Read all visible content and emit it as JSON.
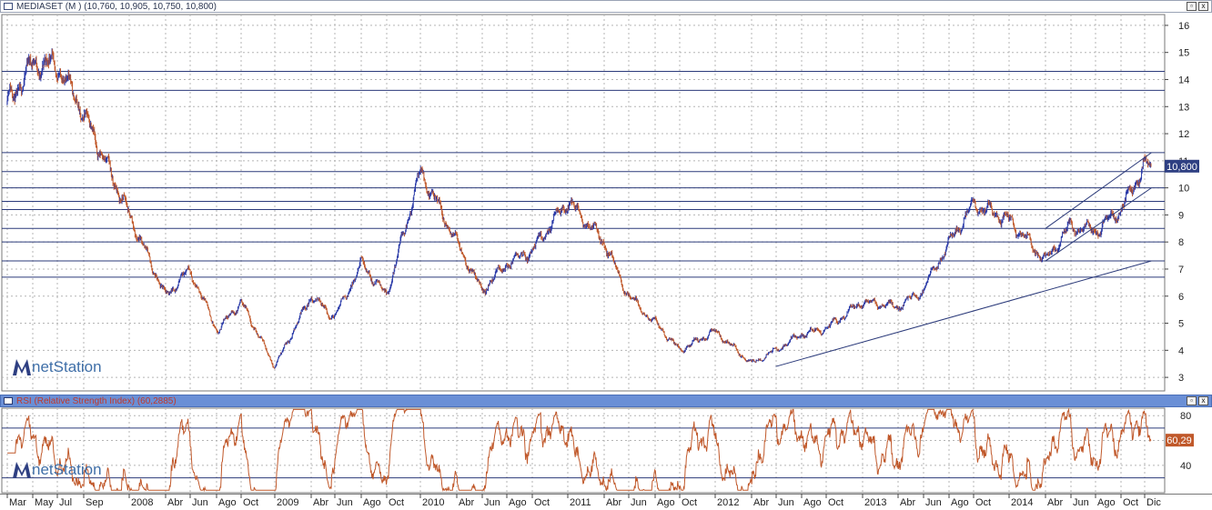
{
  "main_panel": {
    "title": "MEDIASET (M ) (10,760, 10,905, 10,750, 10,800)",
    "price_badge": "10,800",
    "restore_label": "▫",
    "close_label": "x"
  },
  "rsi_panel": {
    "title": "RSI (Relative Strength Index) (60,2885)",
    "value_badge": "60,29",
    "restore_label": "▫",
    "close_label": "x"
  },
  "watermark": {
    "text": "netStation"
  },
  "colors": {
    "up_bar": "#2a3aa8",
    "down_bar": "#c0582a",
    "rsi_line": "#c0582a",
    "grid": "#b5b5b5",
    "hline": "#2b3a7a",
    "badge_price": "#2e3f82",
    "badge_rsi": "#c0582a",
    "rsi_title_bar": "#6a8fd6"
  },
  "chart_data": [
    {
      "type": "line",
      "subtype": "ohlc",
      "series": [
        {
          "name": "MEDIASET",
          "x": [
            "2007-03",
            "2007-05",
            "2007-07",
            "2007-09",
            "2008-01",
            "2008-04",
            "2008-06",
            "2008-08",
            "2008-10",
            "2009-01",
            "2009-04",
            "2009-06",
            "2009-08",
            "2009-10",
            "2010-01",
            "2010-04",
            "2010-06",
            "2010-08",
            "2010-10",
            "2011-01",
            "2011-04",
            "2011-06",
            "2011-08",
            "2011-10",
            "2012-01",
            "2012-04",
            "2012-06",
            "2012-08",
            "2012-10",
            "2013-01",
            "2013-04",
            "2013-06",
            "2013-08",
            "2013-10",
            "2014-01",
            "2014-04",
            "2014-06",
            "2014-08",
            "2014-10",
            "2014-12"
          ],
          "values": [
            13.1,
            14.6,
            14.5,
            12.8,
            9.0,
            6.0,
            7.0,
            4.7,
            5.8,
            3.4,
            6.0,
            5.2,
            7.2,
            6.0,
            10.6,
            8.0,
            6.2,
            7.2,
            7.7,
            9.5,
            8.0,
            6.0,
            5.0,
            4.0,
            4.7,
            3.5,
            4.0,
            4.6,
            4.8,
            5.8,
            5.6,
            6.2,
            8.0,
            9.4,
            8.8,
            7.3,
            8.6,
            8.4,
            9.2,
            10.8
          ]
        }
      ],
      "y_ticks": [
        3,
        4,
        5,
        6,
        7,
        8,
        9,
        10,
        11,
        12,
        13,
        14,
        15,
        16
      ],
      "ylim": [
        2.5,
        16.4
      ],
      "horizontal_levels": [
        14.3,
        13.6,
        11.3,
        10.6,
        10.0,
        9.5,
        9.2,
        8.5,
        8.0,
        7.3,
        6.7
      ],
      "trendlines": [
        {
          "from": [
            "2012-06",
            3.4
          ],
          "to": [
            "2014-04",
            7.3
          ]
        },
        {
          "from": [
            "2014-04",
            7.3
          ],
          "to": [
            "2014-12",
            10.0
          ]
        },
        {
          "from": [
            "2014-04",
            8.5
          ],
          "to": [
            "2014-12",
            11.3
          ]
        }
      ],
      "last_value": 10.8,
      "grid": true
    },
    {
      "type": "line",
      "title": "RSI (Relative Strength Index) (60,2885)",
      "series": [
        {
          "name": "RSI",
          "value": 60.29
        }
      ],
      "y_ticks": [
        40,
        60,
        80
      ],
      "ylim": [
        18,
        86
      ],
      "horizontal_levels": [
        70,
        30
      ],
      "grid": true
    }
  ],
  "x_axis": {
    "ticks": [
      {
        "label": "Mar",
        "t": 2007.17
      },
      {
        "label": "May",
        "t": 2007.33
      },
      {
        "label": "Jul",
        "t": 2007.5
      },
      {
        "label": "Sep",
        "t": 2007.67
      },
      {
        "label": "2008",
        "t": 2008.0
      },
      {
        "label": "Abr",
        "t": 2008.25
      },
      {
        "label": "Jun",
        "t": 2008.42
      },
      {
        "label": "Ago",
        "t": 2008.58
      },
      {
        "label": "Oct",
        "t": 2008.75
      },
      {
        "label": "2009",
        "t": 2009.0
      },
      {
        "label": "Abr",
        "t": 2009.25
      },
      {
        "label": "Jun",
        "t": 2009.42
      },
      {
        "label": "Ago",
        "t": 2009.58
      },
      {
        "label": "Oct",
        "t": 2009.75
      },
      {
        "label": "2010",
        "t": 2010.0
      },
      {
        "label": "Abr",
        "t": 2010.25
      },
      {
        "label": "Jun",
        "t": 2010.42
      },
      {
        "label": "Ago",
        "t": 2010.58
      },
      {
        "label": "Oct",
        "t": 2010.75
      },
      {
        "label": "2011",
        "t": 2011.0
      },
      {
        "label": "Abr",
        "t": 2011.25
      },
      {
        "label": "Jun",
        "t": 2011.42
      },
      {
        "label": "Ago",
        "t": 2011.58
      },
      {
        "label": "Oct",
        "t": 2011.75
      },
      {
        "label": "2012",
        "t": 2012.0
      },
      {
        "label": "Abr",
        "t": 2012.25
      },
      {
        "label": "Jun",
        "t": 2012.42
      },
      {
        "label": "Ago",
        "t": 2012.58
      },
      {
        "label": "Oct",
        "t": 2012.75
      },
      {
        "label": "2013",
        "t": 2013.0
      },
      {
        "label": "Abr",
        "t": 2013.25
      },
      {
        "label": "Jun",
        "t": 2013.42
      },
      {
        "label": "Ago",
        "t": 2013.58
      },
      {
        "label": "Oct",
        "t": 2013.75
      },
      {
        "label": "2014",
        "t": 2014.0
      },
      {
        "label": "Abr",
        "t": 2014.25
      },
      {
        "label": "Jun",
        "t": 2014.42
      },
      {
        "label": "Ago",
        "t": 2014.58
      },
      {
        "label": "Oct",
        "t": 2014.75
      },
      {
        "label": "Dic",
        "t": 2014.92
      }
    ]
  }
}
